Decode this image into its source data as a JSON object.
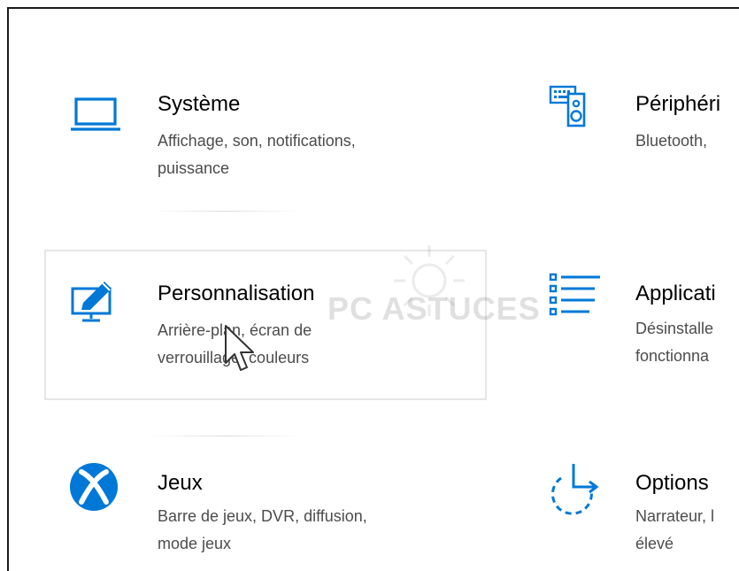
{
  "accent_color": "#0078d7",
  "tiles": [
    {
      "name": "Système",
      "desc": "Affichage, son, notifications,\npuissance",
      "icon": "laptop-icon"
    },
    {
      "name": "Périphéri",
      "desc": "Bluetooth,",
      "icon": "keyboard-speaker-icon"
    },
    {
      "name": "Personnalisation",
      "desc": "Arrière-plan, écran de\nverrouillage, couleurs",
      "icon": "paintbrush-monitor-icon"
    },
    {
      "name": "Applicati",
      "desc": "Désinstalle\nfonctionna",
      "icon": "apps-list-icon"
    },
    {
      "name": "Jeux",
      "desc": "Barre de jeux, DVR, diffusion,\nmode jeux",
      "icon": "xbox-icon"
    },
    {
      "name": "Options",
      "desc": "Narrateur, l\nélevé",
      "icon": "ease-of-access-icon"
    }
  ],
  "watermark": {
    "text": "PC ASTUCES"
  }
}
